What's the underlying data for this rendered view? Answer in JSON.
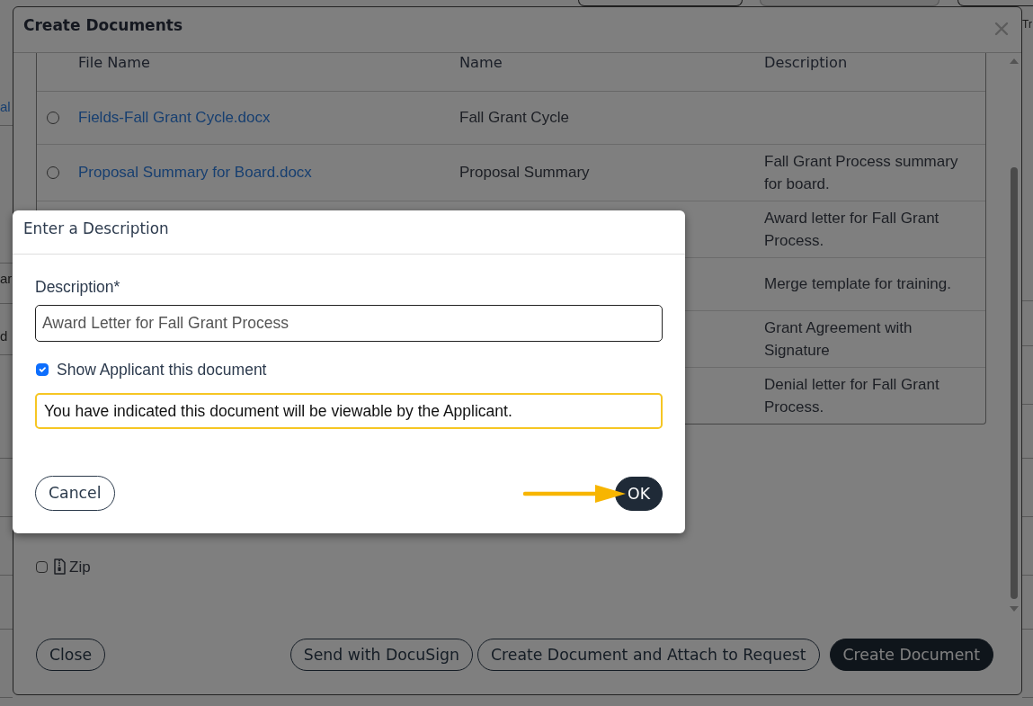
{
  "background_page": {
    "left_texts": [
      {
        "text": "al",
        "kind": "link"
      },
      {
        "text": "ar",
        "kind": "text"
      },
      {
        "text": "d",
        "kind": "text"
      }
    ],
    "right_texts": [
      "Tr"
    ]
  },
  "create_documents_modal": {
    "title": "Create Documents",
    "table": {
      "columns": [
        "File Name",
        "Name",
        "Description"
      ],
      "rows": [
        {
          "selected": false,
          "file_name": "Fields-Fall Grant Cycle.docx",
          "name": "Fall Grant Cycle"
        },
        {
          "selected": false,
          "file_name": "Proposal Summary for Board.docx",
          "name": "Proposal Summary",
          "description": "Fall Grant Process summary for board."
        },
        {
          "description": "Award letter for Fall Grant Process."
        },
        {
          "description": "Merge template for training."
        },
        {
          "description": "Grant Agreement with Signature"
        },
        {
          "description": "Denial letter for Fall Grant Process."
        }
      ]
    },
    "options": [
      {
        "label": "Zip",
        "checked": false
      }
    ],
    "buttons_left": [
      {
        "label": "Close",
        "kind": "outline"
      }
    ],
    "buttons_right": [
      {
        "label": "Send with DocuSign",
        "kind": "outline"
      },
      {
        "label": "Create Document and Attach to Request",
        "kind": "outline"
      },
      {
        "label": "Create Document",
        "kind": "filled"
      }
    ]
  },
  "description_dialog": {
    "title": "Enter a Description",
    "field": {
      "label": "Description*",
      "value": "Award Letter for Fall Grant Process"
    },
    "show_applicant": {
      "label": "Show Applicant this document",
      "checked": true
    },
    "notice": "You have indicated this document will be viewable by the Applicant.",
    "buttons_left": [
      {
        "label": "Cancel",
        "kind": "outline"
      }
    ],
    "buttons_right": [
      {
        "label": "OK",
        "kind": "filled"
      }
    ]
  }
}
